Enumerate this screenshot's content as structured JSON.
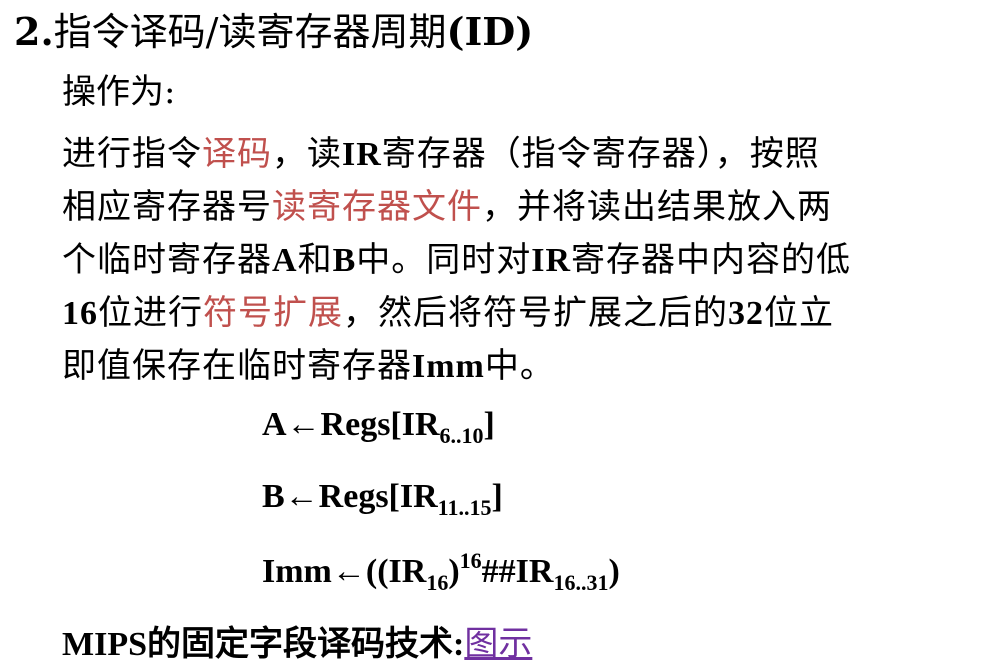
{
  "title": {
    "number": "2.",
    "text": "指令译码/读寄存器周期",
    "abbr": "(ID)"
  },
  "subtitle": "操作为:",
  "paragraph": {
    "line1": {
      "t1": "进行指令",
      "hl1": "译码",
      "t2": "，读",
      "b1": "IR",
      "t3": "寄存器（指令寄存器），按照"
    },
    "line2": {
      "t1": "相应寄存器号",
      "hl1": "读寄存器文件",
      "t2": "，并将读出结果放入两"
    },
    "line3": {
      "t1": "个临时寄存器",
      "b1": "A",
      "t2": "和",
      "b2": "B",
      "t3": "中。同时对",
      "b3": "IR",
      "t4": "寄存器中内容的低"
    },
    "line4": {
      "b1": "16",
      "t1": "位进行",
      "hl1": "符号扩展",
      "t2": "，然后将符号扩展之后的",
      "b2": "32",
      "t3": "位立"
    },
    "line5": {
      "t1": "即值保存在临时寄存器",
      "b1": "Imm",
      "t2": "中。"
    }
  },
  "formulas": {
    "f1": {
      "lhs": "A←Regs[IR",
      "sub": "6..10",
      "rhs": "]"
    },
    "f2": {
      "lhs": "B←Regs[IR",
      "sub": "11..15",
      "rhs": "]"
    },
    "f3": {
      "lhs": "Imm←((IR",
      "sub1": "16",
      "mid": ")",
      "sup": "16",
      "hash": "##IR",
      "sub2": "16..31",
      "rhs": ")"
    }
  },
  "footer": {
    "label": "MIPS的固定字段译码技术:",
    "link": "图示"
  },
  "colors": {
    "highlight": "#c0504d",
    "link": "#7030a0",
    "text": "#000000"
  }
}
